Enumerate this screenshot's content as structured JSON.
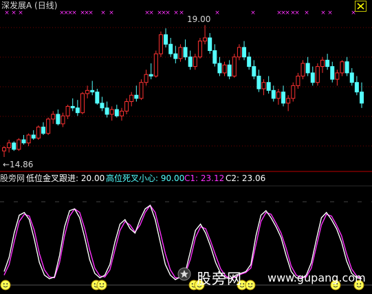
{
  "window": {
    "title": "深发展A (日线)",
    "close_icon": "close-x-icon"
  },
  "colors": {
    "bg": "#000000",
    "up": "#ff3232",
    "down": "#54ffff",
    "grid": "#7a0000",
    "divider": "#bb0000",
    "white_line": "#ffffff",
    "magenta_line": "#ff32ff",
    "signal_x": "#ff32ff",
    "gold_cross": "#ffff00",
    "dead_cross": "#54ffff",
    "c1": "#ff32ff",
    "c2": "#ffffff"
  },
  "price_panel": {
    "high_marker": "19.00",
    "low_marker": "←14.86"
  },
  "indicator": {
    "name": "股旁网",
    "low_label": "低位金叉跟进: 20.00",
    "high_label": "高位死叉小心: 90.00",
    "c1_label": "C1: 23.12",
    "c2_label": "C2: 23.06"
  },
  "watermark": {
    "text": "股旁网",
    "url": "www.gupang.com",
    "icon": "watermark-star-icon"
  },
  "chart_data": [
    {
      "type": "candlestick",
      "series": [
        {
          "name": "price",
          "ohlc": [
            [
              15.05,
              15.2,
              14.86,
              15.15
            ],
            [
              15.15,
              15.4,
              15.0,
              15.3
            ],
            [
              15.3,
              15.35,
              15.05,
              15.1
            ],
            [
              15.1,
              15.45,
              15.05,
              15.4
            ],
            [
              15.4,
              15.55,
              15.25,
              15.3
            ],
            [
              15.3,
              15.6,
              15.2,
              15.55
            ],
            [
              15.55,
              15.7,
              15.4,
              15.45
            ],
            [
              15.45,
              15.85,
              15.4,
              15.8
            ],
            [
              15.8,
              15.95,
              15.55,
              15.6
            ],
            [
              15.6,
              16.1,
              15.55,
              16.05
            ],
            [
              16.05,
              16.3,
              15.9,
              16.2
            ],
            [
              16.2,
              16.35,
              15.85,
              15.9
            ],
            [
              15.9,
              16.25,
              15.8,
              16.15
            ],
            [
              16.15,
              16.5,
              16.05,
              16.45
            ],
            [
              16.45,
              16.7,
              16.3,
              16.4
            ],
            [
              16.4,
              16.65,
              16.15,
              16.25
            ],
            [
              16.25,
              16.9,
              16.2,
              16.85
            ],
            [
              16.85,
              17.1,
              16.7,
              16.95
            ],
            [
              16.95,
              17.25,
              16.8,
              16.9
            ],
            [
              16.9,
              17.0,
              16.5,
              16.55
            ],
            [
              16.55,
              16.75,
              16.3,
              16.4
            ],
            [
              16.4,
              16.6,
              16.1,
              16.2
            ],
            [
              16.2,
              16.45,
              16.0,
              16.35
            ],
            [
              16.35,
              16.5,
              16.1,
              16.15
            ],
            [
              16.15,
              16.4,
              16.0,
              16.3
            ],
            [
              16.3,
              16.7,
              16.2,
              16.6
            ],
            [
              16.6,
              16.9,
              16.45,
              16.8
            ],
            [
              16.8,
              17.1,
              16.6,
              16.7
            ],
            [
              16.7,
              17.3,
              16.65,
              17.2
            ],
            [
              17.2,
              17.6,
              17.1,
              17.45
            ],
            [
              17.45,
              17.8,
              17.3,
              17.4
            ],
            [
              17.4,
              18.2,
              17.35,
              18.1
            ],
            [
              18.1,
              18.8,
              18.0,
              18.7
            ],
            [
              18.7,
              18.9,
              18.3,
              18.4
            ],
            [
              18.4,
              18.6,
              18.0,
              18.1
            ],
            [
              18.1,
              18.35,
              17.8,
              17.95
            ],
            [
              17.95,
              18.4,
              17.85,
              18.3
            ],
            [
              18.3,
              18.55,
              17.9,
              18.0
            ],
            [
              18.0,
              18.2,
              17.6,
              17.7
            ],
            [
              17.7,
              18.1,
              17.6,
              18.0
            ],
            [
              18.0,
              18.6,
              17.95,
              18.5
            ],
            [
              18.5,
              19.0,
              18.4,
              18.6
            ],
            [
              18.6,
              18.75,
              18.1,
              18.2
            ],
            [
              18.2,
              18.4,
              17.7,
              17.8
            ],
            [
              17.8,
              18.0,
              17.4,
              17.5
            ],
            [
              17.5,
              17.85,
              17.4,
              17.75
            ],
            [
              17.75,
              17.9,
              17.3,
              17.4
            ],
            [
              17.4,
              18.1,
              17.35,
              18.0
            ],
            [
              18.0,
              18.4,
              17.9,
              18.3
            ],
            [
              18.3,
              18.5,
              17.9,
              18.0
            ],
            [
              18.0,
              18.15,
              17.6,
              17.7
            ],
            [
              17.7,
              17.9,
              17.3,
              17.4
            ],
            [
              17.4,
              17.6,
              16.9,
              17.0
            ],
            [
              17.0,
              17.3,
              16.8,
              17.2
            ],
            [
              17.2,
              17.4,
              16.85,
              16.95
            ],
            [
              16.95,
              17.1,
              16.6,
              16.7
            ],
            [
              16.7,
              17.0,
              16.5,
              16.9
            ],
            [
              16.9,
              17.1,
              16.45,
              16.55
            ],
            [
              16.55,
              16.8,
              16.3,
              16.7
            ],
            [
              16.7,
              17.2,
              16.6,
              17.1
            ],
            [
              17.1,
              17.5,
              17.0,
              17.4
            ],
            [
              17.4,
              17.9,
              17.3,
              17.8
            ],
            [
              17.8,
              18.0,
              17.4,
              17.5
            ],
            [
              17.5,
              17.7,
              17.1,
              17.2
            ],
            [
              17.2,
              17.8,
              17.1,
              17.7
            ],
            [
              17.7,
              18.0,
              17.5,
              17.9
            ],
            [
              17.9,
              18.1,
              17.6,
              17.7
            ],
            [
              17.7,
              17.85,
              17.2,
              17.3
            ],
            [
              17.3,
              17.6,
              17.1,
              17.5
            ],
            [
              17.5,
              17.9,
              17.4,
              17.85
            ],
            [
              17.85,
              18.0,
              17.4,
              17.5
            ],
            [
              17.5,
              17.65,
              17.1,
              17.2
            ],
            [
              17.2,
              17.4,
              16.8,
              16.9
            ],
            [
              16.9,
              17.2,
              16.4,
              16.55
            ]
          ]
        }
      ],
      "annotations": [
        "19.00",
        "←14.86"
      ],
      "signal_markers": "magenta x marks along top edge"
    },
    {
      "type": "line",
      "series": [
        {
          "name": "C1",
          "values": [
            12,
            28,
            55,
            75,
            78,
            70,
            48,
            22,
            8,
            4,
            6,
            30,
            62,
            80,
            82,
            72,
            50,
            25,
            10,
            5,
            8,
            20,
            45,
            65,
            70,
            60,
            55,
            70,
            82,
            86,
            70,
            45,
            20,
            8,
            3,
            6,
            12,
            35,
            58,
            65,
            55,
            40,
            22,
            10,
            5,
            4,
            8,
            10,
            12,
            20,
            52,
            75,
            80,
            72,
            62,
            50,
            30,
            12,
            5,
            4,
            8,
            22,
            48,
            72,
            78,
            70,
            60,
            45,
            24,
            10,
            5,
            4
          ]
        },
        {
          "name": "C2",
          "values": [
            8,
            20,
            45,
            68,
            76,
            74,
            58,
            32,
            14,
            6,
            5,
            22,
            52,
            74,
            82,
            78,
            60,
            36,
            16,
            7,
            6,
            14,
            36,
            58,
            68,
            64,
            56,
            64,
            78,
            86,
            78,
            56,
            32,
            14,
            5,
            5,
            10,
            26,
            50,
            62,
            60,
            46,
            30,
            15,
            7,
            4,
            6,
            9,
            11,
            16,
            42,
            68,
            78,
            76,
            66,
            55,
            38,
            18,
            8,
            5,
            6,
            16,
            40,
            64,
            76,
            74,
            64,
            52,
            32,
            15,
            7,
            4
          ]
        }
      ],
      "ylim": [
        0,
        100
      ],
      "thresholds": [
        20,
        90
      ]
    }
  ]
}
